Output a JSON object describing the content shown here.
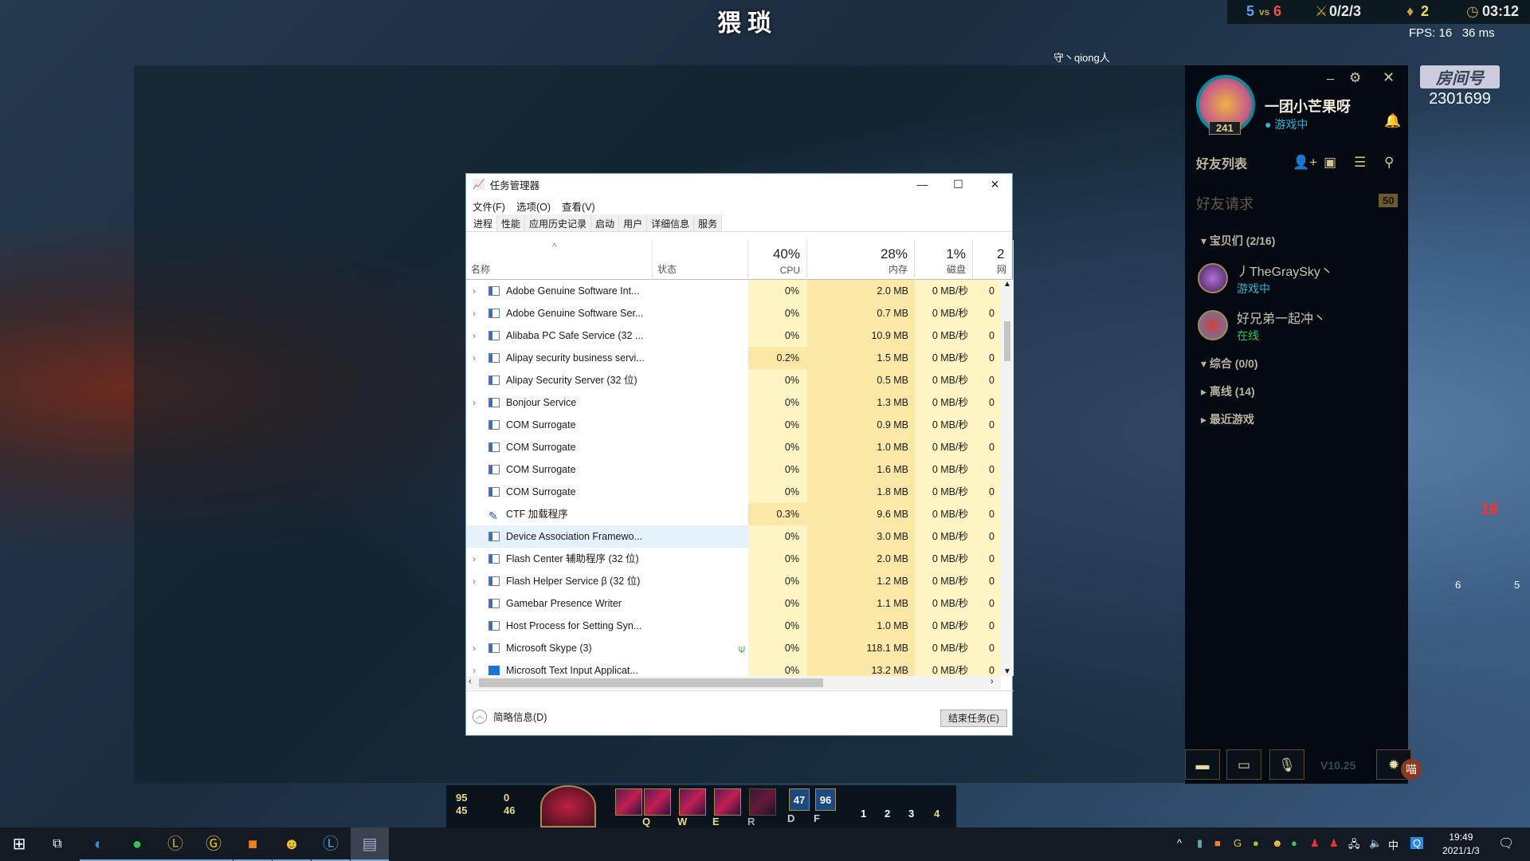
{
  "game": {
    "title": "猥琐",
    "player_tag": "守丶qiong人",
    "score_blue": "5",
    "vs": "vs",
    "score_red": "6",
    "kda": "0/2/3",
    "wards": "2",
    "time": "03:12",
    "fps": "FPS: 16",
    "ping": "36 ms",
    "room_label": "房间号",
    "room_number": "2301699",
    "stats": {
      "ad": "95",
      "ap": "0",
      "armor": "45",
      "mr": "46"
    },
    "skills": [
      "Q",
      "W",
      "E",
      "R"
    ],
    "summoners": [
      {
        "key": "D",
        "cd": "47"
      },
      {
        "key": "F",
        "cd": "96"
      }
    ],
    "items": [
      "1",
      "2",
      "3",
      "4"
    ],
    "ally_kills": "16",
    "ally_level_a": "6",
    "ally_level_b": "5"
  },
  "task_manager": {
    "title": "任务管理器",
    "menu": [
      "文件(F)",
      "选项(O)",
      "查看(V)"
    ],
    "tabs": [
      "进程",
      "性能",
      "应用历史记录",
      "启动",
      "用户",
      "详细信息",
      "服务"
    ],
    "active_tab": "进程",
    "columns": {
      "name": "名称",
      "status": "状态",
      "cpu_pct": "40%",
      "cpu": "CPU",
      "mem_pct": "28%",
      "mem": "内存",
      "disk_pct": "1%",
      "disk": "磁盘",
      "net_pct": "2",
      "net": "网"
    },
    "rows": [
      {
        "name": "Adobe Genuine Software Int...",
        "exp": true,
        "cpu": "0%",
        "mem": "2.0 MB",
        "disk": "0 MB/秒",
        "net": "0"
      },
      {
        "name": "Adobe Genuine Software Ser...",
        "exp": true,
        "cpu": "0%",
        "mem": "0.7 MB",
        "disk": "0 MB/秒",
        "net": "0"
      },
      {
        "name": "Alibaba PC Safe Service (32 ...",
        "exp": true,
        "cpu": "0%",
        "mem": "10.9 MB",
        "disk": "0 MB/秒",
        "net": "0"
      },
      {
        "name": "Alipay security business servi...",
        "exp": true,
        "cpu": "0.2%",
        "mem": "1.5 MB",
        "disk": "0 MB/秒",
        "net": "0"
      },
      {
        "name": "Alipay Security Server (32 位)",
        "exp": false,
        "cpu": "0%",
        "mem": "0.5 MB",
        "disk": "0 MB/秒",
        "net": "0"
      },
      {
        "name": "Bonjour Service",
        "exp": true,
        "cpu": "0%",
        "mem": "1.3 MB",
        "disk": "0 MB/秒",
        "net": "0"
      },
      {
        "name": "COM Surrogate",
        "exp": false,
        "cpu": "0%",
        "mem": "0.9 MB",
        "disk": "0 MB/秒",
        "net": "0"
      },
      {
        "name": "COM Surrogate",
        "exp": false,
        "cpu": "0%",
        "mem": "1.0 MB",
        "disk": "0 MB/秒",
        "net": "0"
      },
      {
        "name": "COM Surrogate",
        "exp": false,
        "cpu": "0%",
        "mem": "1.6 MB",
        "disk": "0 MB/秒",
        "net": "0"
      },
      {
        "name": "COM Surrogate",
        "exp": false,
        "cpu": "0%",
        "mem": "1.8 MB",
        "disk": "0 MB/秒",
        "net": "0"
      },
      {
        "name": "CTF 加载程序",
        "exp": false,
        "icon": "pen",
        "cpu": "0.3%",
        "mem": "9.6 MB",
        "disk": "0 MB/秒",
        "net": "0"
      },
      {
        "name": "Device Association Framewo...",
        "exp": false,
        "selected": true,
        "cpu": "0%",
        "mem": "3.0 MB",
        "disk": "0 MB/秒",
        "net": "0"
      },
      {
        "name": "Flash Center 辅助程序 (32 位)",
        "exp": true,
        "cpu": "0%",
        "mem": "2.0 MB",
        "disk": "0 MB/秒",
        "net": "0"
      },
      {
        "name": "Flash Helper Service β (32 位)",
        "exp": true,
        "cpu": "0%",
        "mem": "1.2 MB",
        "disk": "0 MB/秒",
        "net": "0"
      },
      {
        "name": "Gamebar Presence Writer",
        "exp": false,
        "cpu": "0%",
        "mem": "1.1 MB",
        "disk": "0 MB/秒",
        "net": "0"
      },
      {
        "name": "Host Process for Setting Syn...",
        "exp": false,
        "cpu": "0%",
        "mem": "1.0 MB",
        "disk": "0 MB/秒",
        "net": "0"
      },
      {
        "name": "Microsoft Skype (3)",
        "exp": true,
        "status_icon": "leaf-icon",
        "cpu": "0%",
        "mem": "118.1 MB",
        "disk": "0 MB/秒",
        "net": "0"
      },
      {
        "name": "Microsoft Text Input Applicat...",
        "exp": true,
        "icon": "blue",
        "cpu": "0%",
        "mem": "13.2 MB",
        "disk": "0 MB/秒",
        "net": "0"
      }
    ],
    "fewer_details": "简略信息(D)",
    "end_task": "结束任务(E)"
  },
  "friends": {
    "username": "一团小芒果呀",
    "status": "游戏中",
    "level": "241",
    "list_title": "好友列表",
    "requests": "好友请求",
    "requests_count": "50",
    "groups": [
      {
        "label": "宝贝们 (2/16)",
        "open": true
      },
      {
        "label": "综合 (0/0)",
        "open": true
      },
      {
        "label": "离线 (14)",
        "open": false
      },
      {
        "label": "最近游戏",
        "open": false
      }
    ],
    "members": [
      {
        "name": "丿TheGraySky丶",
        "status": "游戏中",
        "color": "#27b6d8"
      },
      {
        "name": "好兄弟一起冲丶",
        "status": "在线",
        "color": "#2ec45a"
      }
    ],
    "version": "V10.25",
    "badge": "喵"
  },
  "taskbar": {
    "time": "19:49",
    "date": "2021/1/3",
    "ime": "中"
  },
  "colors": {
    "accent_blue": "#27b6d8",
    "online_green": "#2ec45a",
    "gold": "#d8c48a",
    "cpu_heat": "#fff4c4",
    "mem_heat": "#fbe8a6"
  }
}
